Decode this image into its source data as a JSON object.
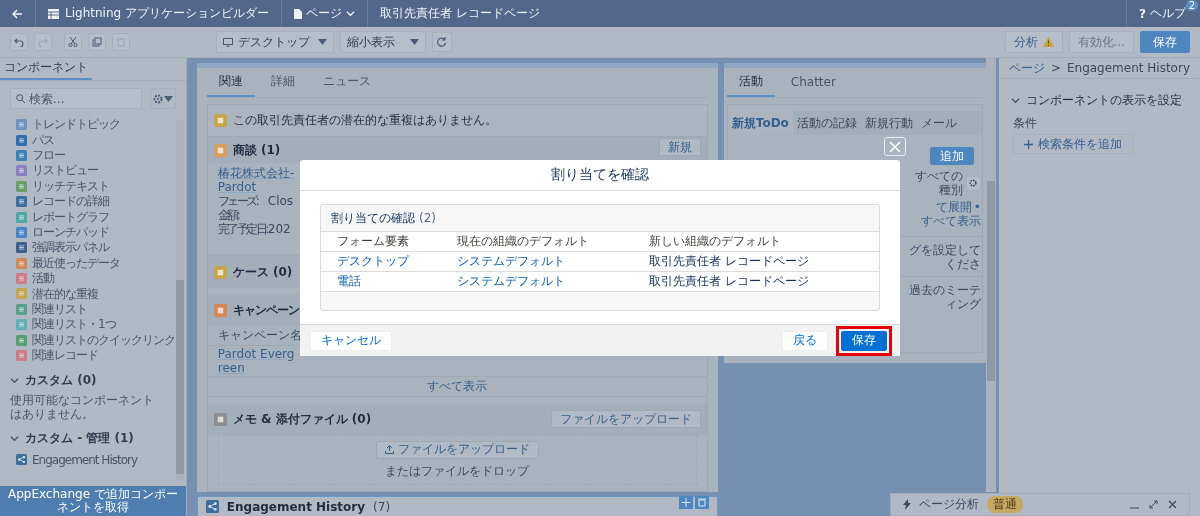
{
  "header": {
    "app_title": "Lightning アプリケーションビルダー",
    "page_menu": "ページ",
    "record_page": "取引先責任者 レコードページ",
    "help_icon": "?",
    "help": "ヘルプ",
    "help_badge": "2"
  },
  "toolbar": {
    "device": "デスクトップ",
    "view": "縮小表示",
    "analyze": "分析",
    "activate": {
      "label": "有効化...",
      "disabled": true
    },
    "save": "保存"
  },
  "components_panel": {
    "tab": "コンポーネント",
    "search_placeholder": "検索...",
    "items": [
      {
        "label": "トレンドトピック",
        "color": "#6f93c2"
      },
      {
        "label": "パス",
        "color": "#2f6fb0"
      },
      {
        "label": "フロー",
        "color": "#3a80b4"
      },
      {
        "label": "リストビュー",
        "color": "#8a80c0"
      },
      {
        "label": "リッチテキスト",
        "color": "#6aa068"
      },
      {
        "label": "レコードの詳細",
        "color": "#3d6e9e"
      },
      {
        "label": "レポートグラフ",
        "color": "#4ea8a8"
      },
      {
        "label": "ローンチパッド",
        "color": "#4a84c4"
      },
      {
        "label": "強調表示パネル",
        "color": "#3d5f8a"
      },
      {
        "label": "最近使ったデータ",
        "color": "#d48858"
      },
      {
        "label": "活動",
        "color": "#d07c88"
      },
      {
        "label": "潜在的な重複",
        "color": "#c4a64c"
      },
      {
        "label": "関連リスト",
        "color": "#58a08a"
      },
      {
        "label": "関連リスト・1つ",
        "color": "#62b0b5"
      },
      {
        "label": "関連リストのクイックリンク",
        "color": "#58a074"
      },
      {
        "label": "関連レコード",
        "color": "#d07c88"
      }
    ],
    "groups": [
      {
        "title": "カスタム (0)",
        "expanded": true,
        "empty_text": "使用可能なコンポーネントはありません。"
      },
      {
        "title": "カスタム - 管理 (1)",
        "expanded": true,
        "items": [
          {
            "label": "Engagement History"
          }
        ]
      }
    ],
    "appexchange": "AppExchange で追加コンポーネントを取得"
  },
  "canvas": {
    "left_column": {
      "tabs": [
        {
          "label": "関連",
          "selected": true
        },
        {
          "label": "詳細",
          "selected": false
        },
        {
          "label": "ニュース",
          "selected": false
        }
      ],
      "duplicates_notice": "この取引先責任者の潜在的な重複はありません。",
      "opportunities": {
        "title": "商談 (1)",
        "new_button": "新規",
        "record": "椿花株式会社-Pardot",
        "fields": [
          {
            "label": "フェーズ:",
            "value": "Clos"
          },
          {
            "label": "金額:"
          },
          {
            "label": "完了予定日:",
            "value": "202"
          }
        ]
      },
      "cases": {
        "title": "ケース (0)"
      },
      "campaigns": {
        "title": "キャンペーン",
        "column": "キャンペーン名",
        "row": "Pardot Evergreen",
        "view_all": "すべて表示"
      },
      "notes": {
        "title": "メモ & 添付ファイル (0)",
        "upload_button": "ファイルをアップロード",
        "drop_button": "ファイルをアップロード",
        "drop_hint": "またはファイルをドロップ"
      },
      "engagement": {
        "title": "Engagement History",
        "count": "(7)"
      }
    },
    "right_column": {
      "tabs": [
        {
          "label": "活動",
          "selected": true
        },
        {
          "label": "Chatter",
          "selected": false
        }
      ],
      "activity_tabs": [
        {
          "label": "新規ToDo",
          "selected": true
        },
        {
          "label": "活動の記録",
          "selected": false
        },
        {
          "label": "新規行動",
          "selected": false
        },
        {
          "label": "メール",
          "selected": false
        }
      ],
      "add_button": "追加",
      "filter": "すべての種別",
      "expand_link": "て展開",
      "separator": "•",
      "view_all_link": "すべて表示",
      "upcoming_text": "グを設定してくださ",
      "past_text": "過去のミーティング"
    }
  },
  "properties_panel": {
    "breadcrumb_root": "ページ",
    "breadcrumb_separator": ">",
    "breadcrumb_current": "Engagement History",
    "section": "コンポーネントの表示を設定",
    "expanded": true,
    "conditions_label": "条件",
    "add_filter": "検索条件を追加"
  },
  "page_analysis": {
    "label": "ページ分析",
    "status": "普通"
  },
  "modal": {
    "title": "割り当てを確認",
    "card_title": "割り当ての確認",
    "count": "(2)",
    "columns": [
      "フォーム要素",
      "現在の組織のデフォルト",
      "新しい組織のデフォルト"
    ],
    "rows": [
      {
        "cells": [
          "デスクトップ",
          "システムデフォルト",
          "取引先責任者 レコードページ"
        ]
      },
      {
        "cells": [
          "電話",
          "システムデフォルト",
          "取引先責任者 レコードページ"
        ]
      }
    ],
    "cancel": "キャンセル",
    "back": "戻る",
    "save": "保存",
    "save_highlighted": true
  }
}
